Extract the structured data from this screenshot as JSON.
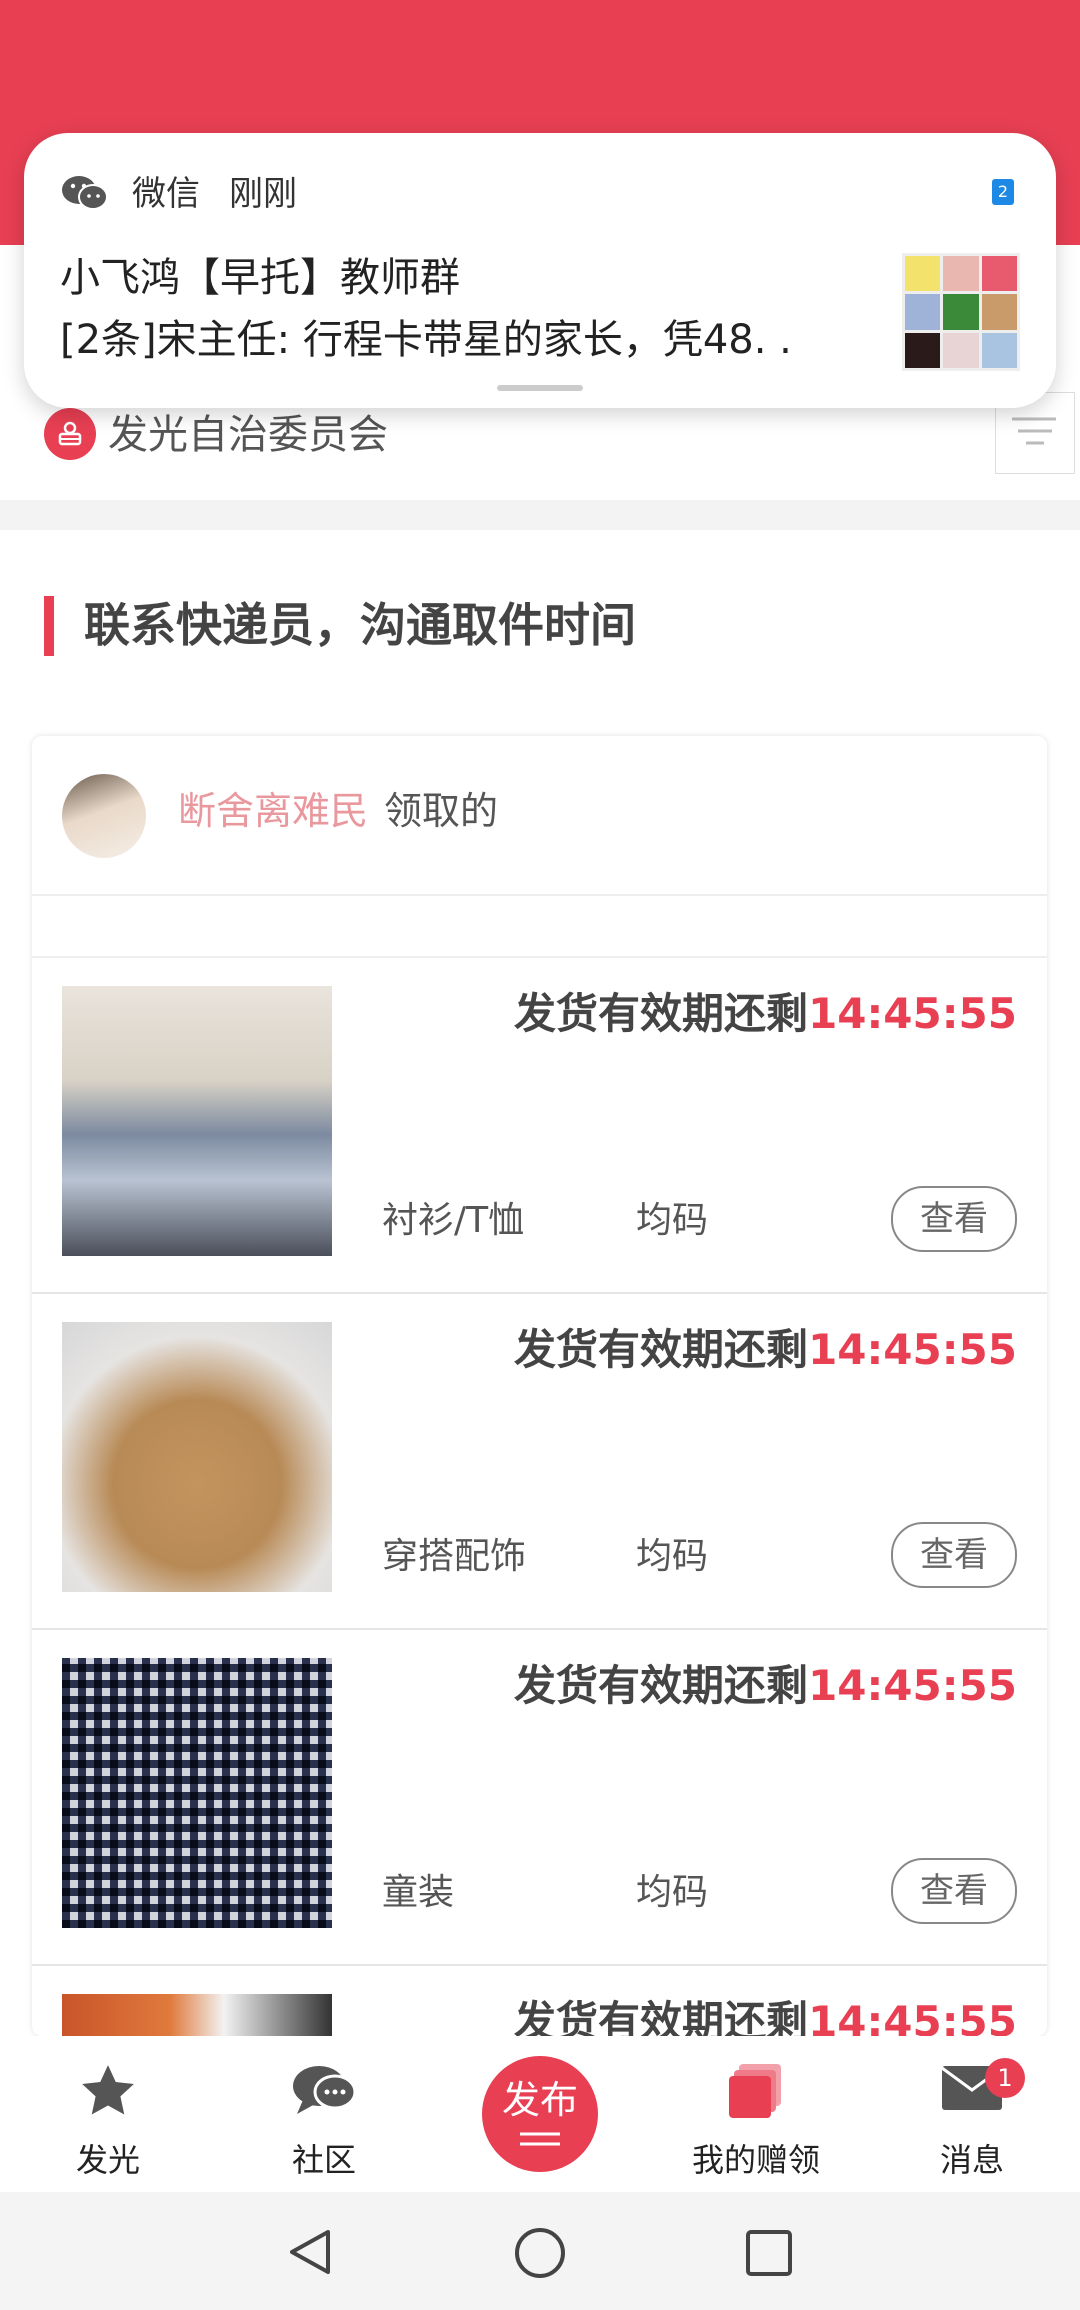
{
  "notification": {
    "app": "微信",
    "time": "刚刚",
    "badge": "2",
    "title": "小飞鸿【早托】教师群",
    "body": "[2条]宋主任: 行程卡带星的家长，凭48. ."
  },
  "org": {
    "name": "发光自治委员会"
  },
  "section": {
    "title": "联系快递员，沟通取件时间"
  },
  "owner": {
    "name": "断舍离难民",
    "suffix": "领取的"
  },
  "items": [
    {
      "deadline_label": "发货有效期还剩",
      "countdown": "14:45:55",
      "category": "衬衫/T恤",
      "size": "均码",
      "action": "查看"
    },
    {
      "deadline_label": "发货有效期还剩",
      "countdown": "14:45:55",
      "category": "穿搭配饰",
      "size": "均码",
      "action": "查看"
    },
    {
      "deadline_label": "发货有效期还剩",
      "countdown": "14:45:55",
      "category": "童装",
      "size": "均码",
      "action": "查看"
    },
    {
      "deadline_label": "发货有效期还剩",
      "countdown": "14:45:55",
      "category": "",
      "size": "",
      "action": ""
    }
  ],
  "tabs": [
    {
      "label": "发光",
      "icon": "star-icon"
    },
    {
      "label": "社区",
      "icon": "chat-bubbles-icon"
    },
    {
      "label": "发布",
      "icon": "publish-icon"
    },
    {
      "label": "我的赠领",
      "icon": "cards-icon"
    },
    {
      "label": "消息",
      "icon": "mail-icon",
      "badge": "1"
    }
  ],
  "colors": {
    "accent": "#e83f53",
    "owner_name": "#e9989e"
  }
}
